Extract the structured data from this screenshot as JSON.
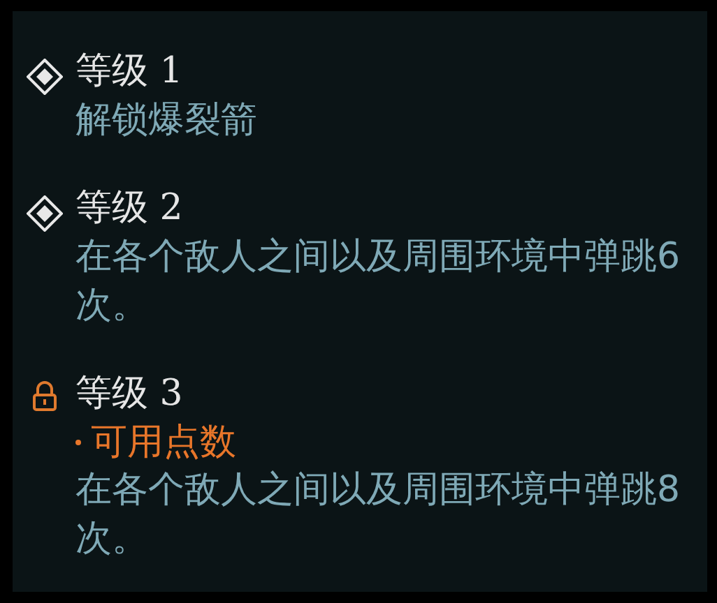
{
  "levels": [
    {
      "title": "等级 1",
      "locked": false,
      "description": "解锁爆裂箭"
    },
    {
      "title": "等级 2",
      "locked": false,
      "description": "在各个敌人之间以及周围环境中弹跳6次。"
    },
    {
      "title": "等级 3",
      "locked": true,
      "cost": "可用点数",
      "description": "在各个敌人之间以及周围环境中弹跳8次。"
    }
  ]
}
